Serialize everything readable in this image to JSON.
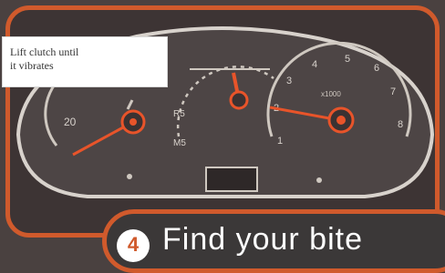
{
  "callout": {
    "line1": "Lift clutch until",
    "line2": "it vibrates"
  },
  "banner": {
    "step_number": "4",
    "title": "Find your bite"
  },
  "dashboard": {
    "left_gauge_label": "20",
    "right_gauge_labels": [
      "1",
      "2",
      "3",
      "4",
      "5",
      "6",
      "7",
      "8"
    ]
  },
  "colors": {
    "accent": "#d05a2c",
    "highlight": "#e8542a",
    "panel": "#3d3434"
  }
}
